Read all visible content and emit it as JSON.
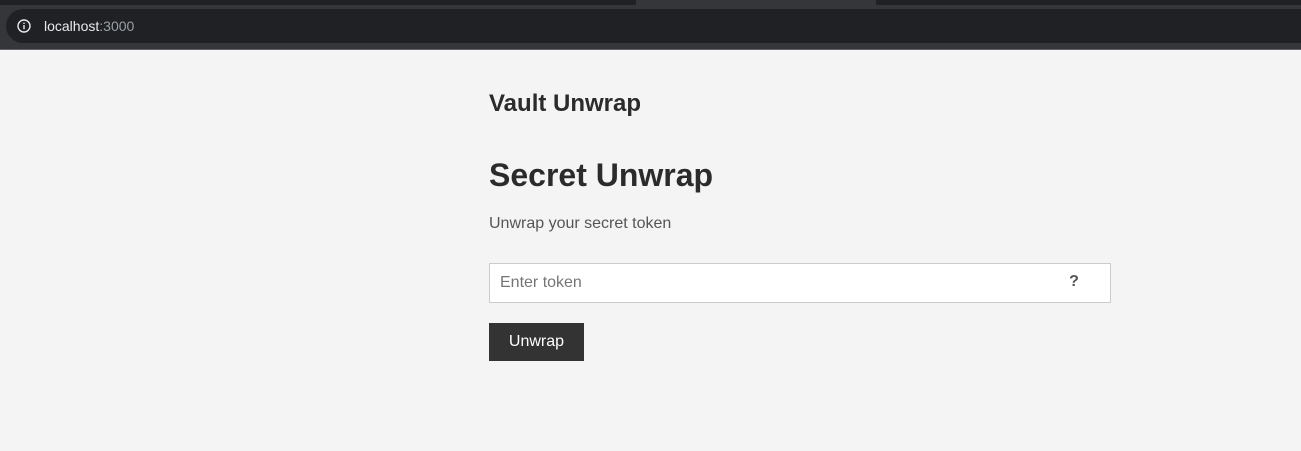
{
  "browser": {
    "url_host": "localhost",
    "url_port": ":3000",
    "info_icon": "info-icon"
  },
  "header": {
    "site_title": "Vault Unwrap"
  },
  "main": {
    "title": "Secret Unwrap",
    "subtitle": "Unwrap your secret token",
    "token_input": {
      "value": "",
      "placeholder": "Enter token"
    },
    "help_icon": {
      "glyph": "?",
      "icon": "question-mark-icon"
    },
    "unwrap_button_label": "Unwrap"
  },
  "colors": {
    "page_background": "#f4f4f4",
    "browser_chrome": "#35363a",
    "button_background": "#333333",
    "heading_text": "#2b2b2b"
  }
}
